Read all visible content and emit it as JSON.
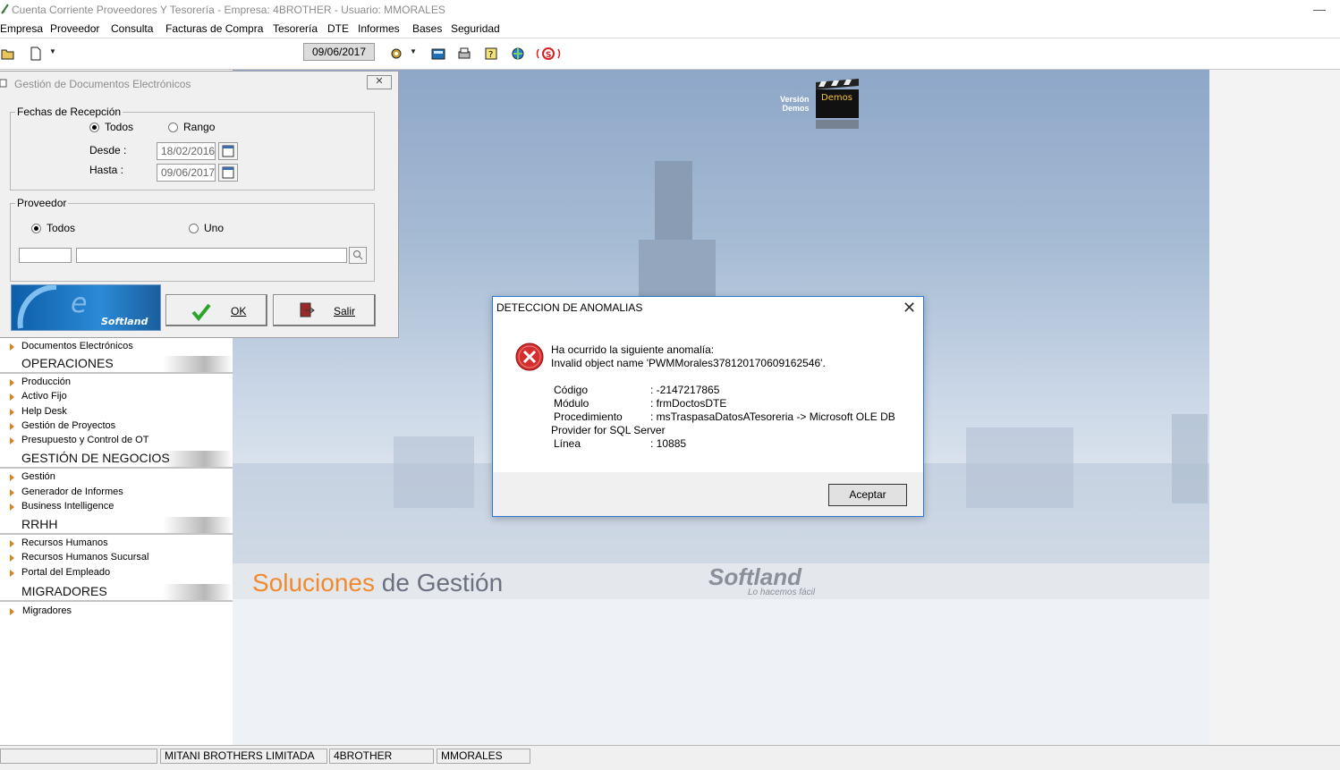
{
  "window": {
    "title": "Cuenta Corriente Proveedores Y Tesorería - Empresa: 4BROTHER - Usuario: MMORALES",
    "minimize_glyph": "—"
  },
  "menu": [
    "Empresa",
    "Proveedor",
    "Consulta",
    "Facturas de Compra",
    "Tesorería",
    "DTE",
    "Informes",
    "Bases",
    "Seguridad"
  ],
  "toolbar": {
    "date": "09/06/2017",
    "icons": [
      "open-folder-icon",
      "new-document-icon",
      "tools-icon",
      "calculator-icon",
      "printer-icon",
      "help-icon",
      "web-icon",
      "softland-s-icon"
    ]
  },
  "doc_window": {
    "title": "Gestión de Documentos Electrónicos",
    "close_glyph": "✕",
    "fechas_group": "Fechas de Recepción",
    "radio_todos": "Todos",
    "radio_rango": "Rango",
    "desde_label": "Desde :",
    "desde_value": "18/02/2016",
    "hasta_label": "Hasta :",
    "hasta_value": "09/06/2017",
    "proveedor_group": "Proveedor",
    "prov_todos": "Todos",
    "prov_uno": "Uno",
    "logo_letter": "e",
    "logo_text": "Softland",
    "ok_label": "OK",
    "salir_label": "Salir"
  },
  "left_nav": {
    "top_item": "Documentos Electrónicos",
    "sections": [
      {
        "header": "OPERACIONES",
        "items": [
          "Producción",
          "Activo Fijo",
          "Help Desk",
          "Gestión de Proyectos",
          "Presupuesto y Control de OT"
        ]
      },
      {
        "header": "GESTIÓN DE NEGOCIOS",
        "items": [
          "Gestión",
          "Generador de Informes",
          "Business Intelligence"
        ]
      },
      {
        "header": "RRHH",
        "items": [
          "Recursos Humanos",
          "Recursos Humanos Sucursal",
          "Portal del Empleado"
        ]
      },
      {
        "header": "MIGRADORES",
        "items": [
          "Migradores"
        ]
      }
    ]
  },
  "background": {
    "soluciones": "Soluciones",
    "de": " de ",
    "gestion": "Gestión",
    "brand": "Softland",
    "tagline": "Lo hacemos fácil",
    "version_label_1": "Versión",
    "version_label_2": "Demos",
    "demo_clap": "Demos"
  },
  "dialog": {
    "title": "DETECCION DE ANOMALIAS",
    "close_glyph": "✕",
    "line1": "Ha ocurrido la siguiente anomalía:",
    "line2": "Invalid object name 'PWMMorales37812017060916254​6'.",
    "codigo_label": "Código",
    "codigo_value": ": -2147217865",
    "modulo_label": "Módulo",
    "modulo_value": ": frmDoctosDTE",
    "proc_label": "Procedimiento",
    "proc_value": ": msTraspasaDatosATesoreria -> Microsoft OLE DB",
    "proc_cont": "Provider for SQL Server",
    "linea_label": "Línea",
    "linea_value": ": 10885",
    "accept_label": "Aceptar"
  },
  "status": {
    "company": "MITANI BROTHERS LIMITADA",
    "code": "4BROTHER",
    "user": "MMORALES"
  },
  "colors": {
    "accent_orange": "#f08a30",
    "dialog_border": "#2b78d0",
    "error_red": "#d32f2f"
  }
}
